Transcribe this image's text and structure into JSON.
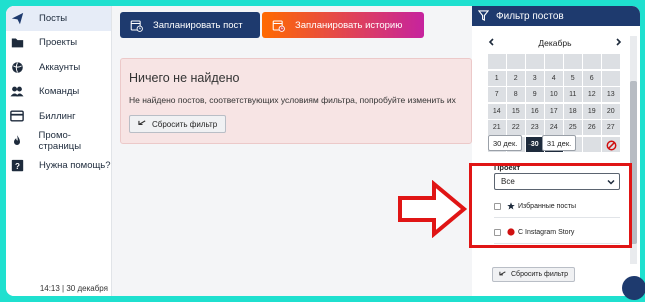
{
  "sidebar": {
    "items": [
      {
        "label": "Посты",
        "icon": "paper-plane-icon",
        "active": true
      },
      {
        "label": "Проекты",
        "icon": "folder-icon",
        "active": false
      },
      {
        "label": "Аккаунты",
        "icon": "globe-icon",
        "active": false
      },
      {
        "label": "Команды",
        "icon": "users-icon",
        "active": false
      },
      {
        "label": "Биллинг",
        "icon": "credit-card-icon",
        "active": false
      },
      {
        "label": "Промо-страницы",
        "icon": "flame-icon",
        "active": false
      },
      {
        "label": "Нужна помощь?",
        "icon": "help-icon",
        "active": false
      }
    ],
    "footer": "14:13 | 30 декабря"
  },
  "toolbar": {
    "schedule_post": "Запланировать пост",
    "schedule_story": "Запланировать историю"
  },
  "notice": {
    "title": "Ничего не найдено",
    "text": "Не найдено постов, соответствующих условиям фильтра, попробуйте изменить их",
    "reset": "Сбросить фильтр"
  },
  "filter_panel": {
    "title": "Фильтр постов",
    "calendar": {
      "month": "Декабрь",
      "days": [
        [
          "",
          "",
          "",
          "",
          "",
          "",
          ""
        ],
        [
          "1",
          "2",
          "3",
          "4",
          "5",
          "6",
          ""
        ],
        [
          "7",
          "8",
          "9",
          "10",
          "11",
          "12",
          "13"
        ],
        [
          "14",
          "15",
          "16",
          "17",
          "18",
          "19",
          "20"
        ],
        [
          "21",
          "22",
          "23",
          "24",
          "25",
          "26",
          "27"
        ],
        [
          "28",
          "29",
          "30",
          "31",
          "",
          "",
          ""
        ]
      ]
    },
    "range_from": "30 дек.",
    "range_to": "31 дек.",
    "project_label": "Проект",
    "project_selected": "Все",
    "options": [
      {
        "label": "Избранные посты",
        "icon": "star-icon"
      },
      {
        "label": "С Instagram Story",
        "icon": "red-dot-icon"
      }
    ],
    "reset": "Сбросить фильтр"
  },
  "colors": {
    "navy": "#1e3a6e",
    "orange": "#ff6a00",
    "magenta": "#c6239e",
    "highlight_red": "#e01515",
    "frame_teal": "#1fe0cf"
  }
}
